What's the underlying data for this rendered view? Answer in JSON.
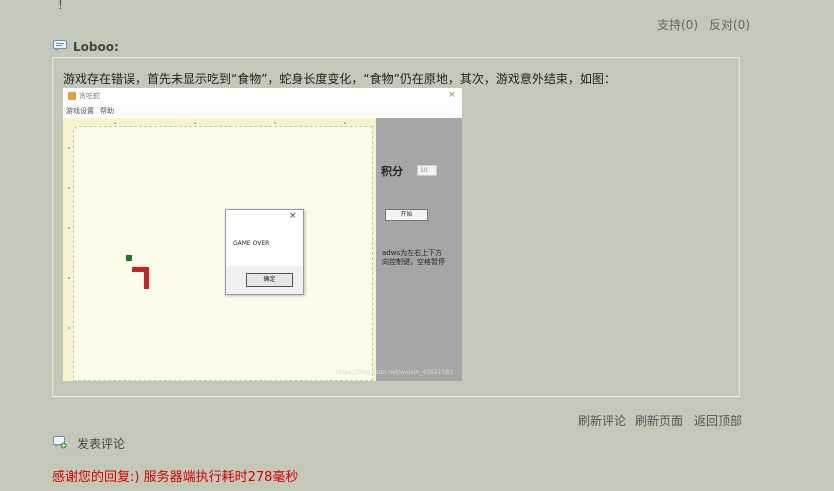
{
  "top": {
    "exclamation": "!",
    "support": "支持(0)",
    "oppose": "反对(0)"
  },
  "comment": {
    "author": "Loboo:",
    "text": "游戏存在错误，首先未显示吃到“食物”，蛇身长度变化，“食物”仍在原地，其次，游戏意外结束，如图：",
    "screenshot": {
      "window_title": "贪吃蛇",
      "close_glyph": "×",
      "menu": [
        "游戏设置",
        "帮助"
      ],
      "score_label": "积分",
      "score_value": "10",
      "start_button": "开始",
      "hint": "adws为左右上下方向控制键，空格暂停",
      "watermark": "https://blog.csdn.net/weixin_43621583",
      "dialog": {
        "close_glyph": "×",
        "message": "GAME OVER",
        "ok": "确定"
      },
      "colors": {
        "snake": "#cc2222",
        "food": "#1a7a2a",
        "panel": "#a6a6a6"
      }
    }
  },
  "footer": {
    "links": [
      "刷新评论",
      "刷新页面",
      "返回顶部"
    ],
    "post_comment": "发表评论",
    "thanks": "感谢您的回复:) 服务器端执行耗时278毫秒"
  },
  "colors": {
    "background": "#c4c8b8",
    "thanks_text": "#d40000"
  }
}
